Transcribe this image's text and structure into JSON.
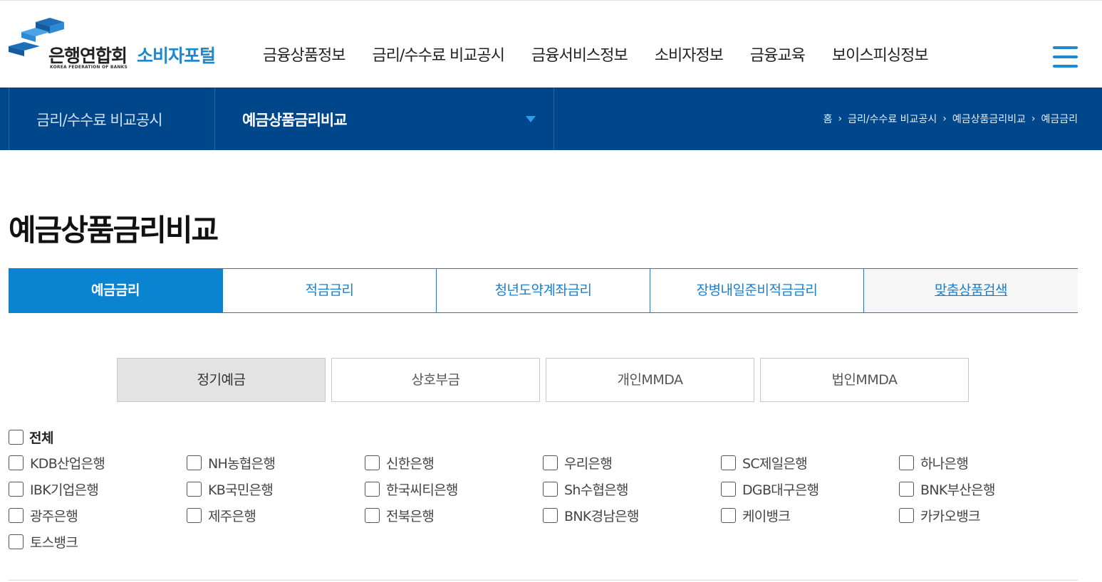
{
  "colors": {
    "primary_blue": "#1e88d1",
    "nav_navy": "#00468a",
    "tab_blue": "#0a84d0"
  },
  "logo": {
    "ko": "은행연합회",
    "en": "KOREA FEDERATION OF BANKS",
    "portal": "소비자포털"
  },
  "gnb": [
    "금융상품정보",
    "금리/수수료 비교공시",
    "금융서비스정보",
    "소비자정보",
    "금융교육",
    "보이스피싱정보"
  ],
  "menu_icon": "hamburger-icon",
  "subnav": {
    "depth1": "금리/수수료 비교공시",
    "depth2": "예금상품금리비교",
    "breadcrumb": [
      "홈",
      "금리/수수료 비교공시",
      "예금상품금리비교",
      "예금금리"
    ]
  },
  "page_title": "예금상품금리비교",
  "tabs": [
    {
      "label": "예금금리",
      "active": true
    },
    {
      "label": "적금금리",
      "active": false
    },
    {
      "label": "청년도약계좌금리",
      "active": false
    },
    {
      "label": "장병내일준비적금금리",
      "active": false
    },
    {
      "label": "맞춤상품검색",
      "active": false
    }
  ],
  "subtabs": [
    {
      "label": "정기예금",
      "active": true
    },
    {
      "label": "상호부금",
      "active": false
    },
    {
      "label": "개인MMDA",
      "active": false
    },
    {
      "label": "법인MMDA",
      "active": false
    }
  ],
  "all_label": "전체",
  "banks": [
    "KDB산업은행",
    "NH농협은행",
    "신한은행",
    "우리은행",
    "SC제일은행",
    "하나은행",
    "IBK기업은행",
    "KB국민은행",
    "한국씨티은행",
    "Sh수협은행",
    "DGB대구은행",
    "BNK부산은행",
    "광주은행",
    "제주은행",
    "전북은행",
    "BNK경남은행",
    "케이뱅크",
    "카카오뱅크",
    "토스뱅크"
  ]
}
